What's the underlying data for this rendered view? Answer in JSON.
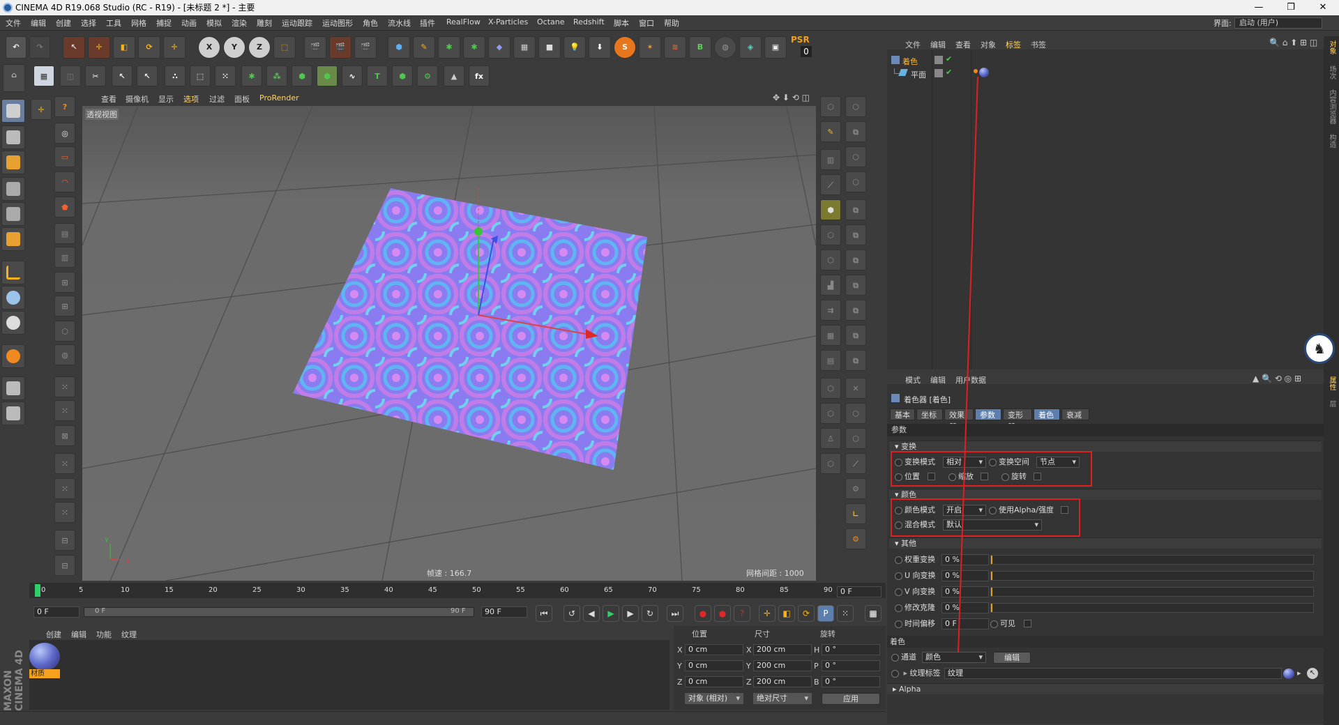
{
  "window": {
    "title": "CINEMA 4D R19.068 Studio (RC - R19) - [未标题 2 *] - 主要",
    "minimize": "—",
    "maximize": "❐",
    "close": "✕"
  },
  "menu": [
    "文件",
    "编辑",
    "创建",
    "选择",
    "工具",
    "网格",
    "捕捉",
    "动画",
    "模拟",
    "渲染",
    "雕刻",
    "运动跟踪",
    "运动图形",
    "角色",
    "流水线",
    "插件",
    "RealFlow",
    "X-Particles",
    "Octane",
    "Redshift",
    "脚本",
    "窗口",
    "帮助"
  ],
  "layout": {
    "label": "界面:",
    "value": "启动 (用户)"
  },
  "psr": {
    "label": "PSR",
    "value": "0"
  },
  "viewport": {
    "menu": [
      "查看",
      "摄像机",
      "显示",
      "选项",
      "过滤",
      "面板",
      "ProRender"
    ],
    "label": "透视视图",
    "fps": "帧速 : 166.7",
    "grid": "网格间距 : 1000 cm"
  },
  "objects": {
    "menu": [
      "文件",
      "编辑",
      "查看",
      "对象",
      "标签",
      "书签"
    ],
    "items": [
      {
        "name": "着色"
      },
      {
        "name": "平面"
      }
    ]
  },
  "attrs": {
    "menu": [
      "模式",
      "编辑",
      "用户数据"
    ],
    "title": "着色器 [着色]",
    "tabs": [
      "基本",
      "坐标",
      "效果器",
      "参数",
      "变形器",
      "着色",
      "衰减"
    ],
    "params_label": "参数",
    "transform": {
      "header": "变换",
      "mode_label": "变换模式",
      "mode_value": "相对",
      "space_label": "变换空间",
      "space_value": "节点",
      "position": "位置",
      "scale": "缩放",
      "rotation": "旋转"
    },
    "color": {
      "header": "颜色",
      "mode_label": "颜色模式",
      "mode_value": "开启",
      "alpha_label": "使用Alpha/强度",
      "blend_label": "混合模式",
      "blend_value": "默认"
    },
    "other": {
      "header": "其他",
      "rows": [
        {
          "label": "权重变换",
          "value": "0 %"
        },
        {
          "label": "U 向变换",
          "value": "0 %"
        },
        {
          "label": "V 向变换",
          "value": "0 %"
        },
        {
          "label": "修改克隆",
          "value": "0 %"
        }
      ],
      "time_label": "时间偏移",
      "time_value": "0 F",
      "visible_label": "可见"
    },
    "shading": {
      "header": "着色",
      "channel_label": "通道",
      "channel_value": "颜色",
      "edit": "编辑",
      "texture_tag_label": "纹理标签",
      "texture_tag_value": "纹理",
      "alpha_header": "Alpha"
    }
  },
  "timeline": {
    "ticks": [
      "0",
      "5",
      "10",
      "15",
      "20",
      "25",
      "30",
      "35",
      "40",
      "45",
      "50",
      "55",
      "60",
      "65",
      "70",
      "75",
      "80",
      "85",
      "90"
    ],
    "frame_end_box": "0 F",
    "start": "0 F",
    "range_left": "0 F",
    "range_right": "90 F",
    "end": "90 F"
  },
  "materials": {
    "menu": [
      "创建",
      "编辑",
      "功能",
      "纹理"
    ],
    "items": [
      {
        "name": "材质"
      }
    ]
  },
  "coords": {
    "headers": [
      "位置",
      "尺寸",
      "旋转"
    ],
    "rows": [
      {
        "axis": "X",
        "pos": "0 cm",
        "size": "200 cm",
        "rot_axis": "H",
        "rot": "0 °"
      },
      {
        "axis": "Y",
        "pos": "0 cm",
        "size": "200 cm",
        "rot_axis": "P",
        "rot": "0 °"
      },
      {
        "axis": "Z",
        "pos": "0 cm",
        "size": "200 cm",
        "rot_axis": "B",
        "rot": "0 °"
      }
    ],
    "mode": "对象 (相对)",
    "size_mode": "绝对尺寸",
    "apply": "应用"
  },
  "right_vertical_tabs": [
    "对象",
    "场次",
    "内容浏览器",
    "构造",
    "属性",
    "层"
  ],
  "brand": "MAXON CINEMA 4D",
  "colors": {
    "accent": "#5c7fae",
    "highlight": "#e02020",
    "panel": "#343434"
  }
}
